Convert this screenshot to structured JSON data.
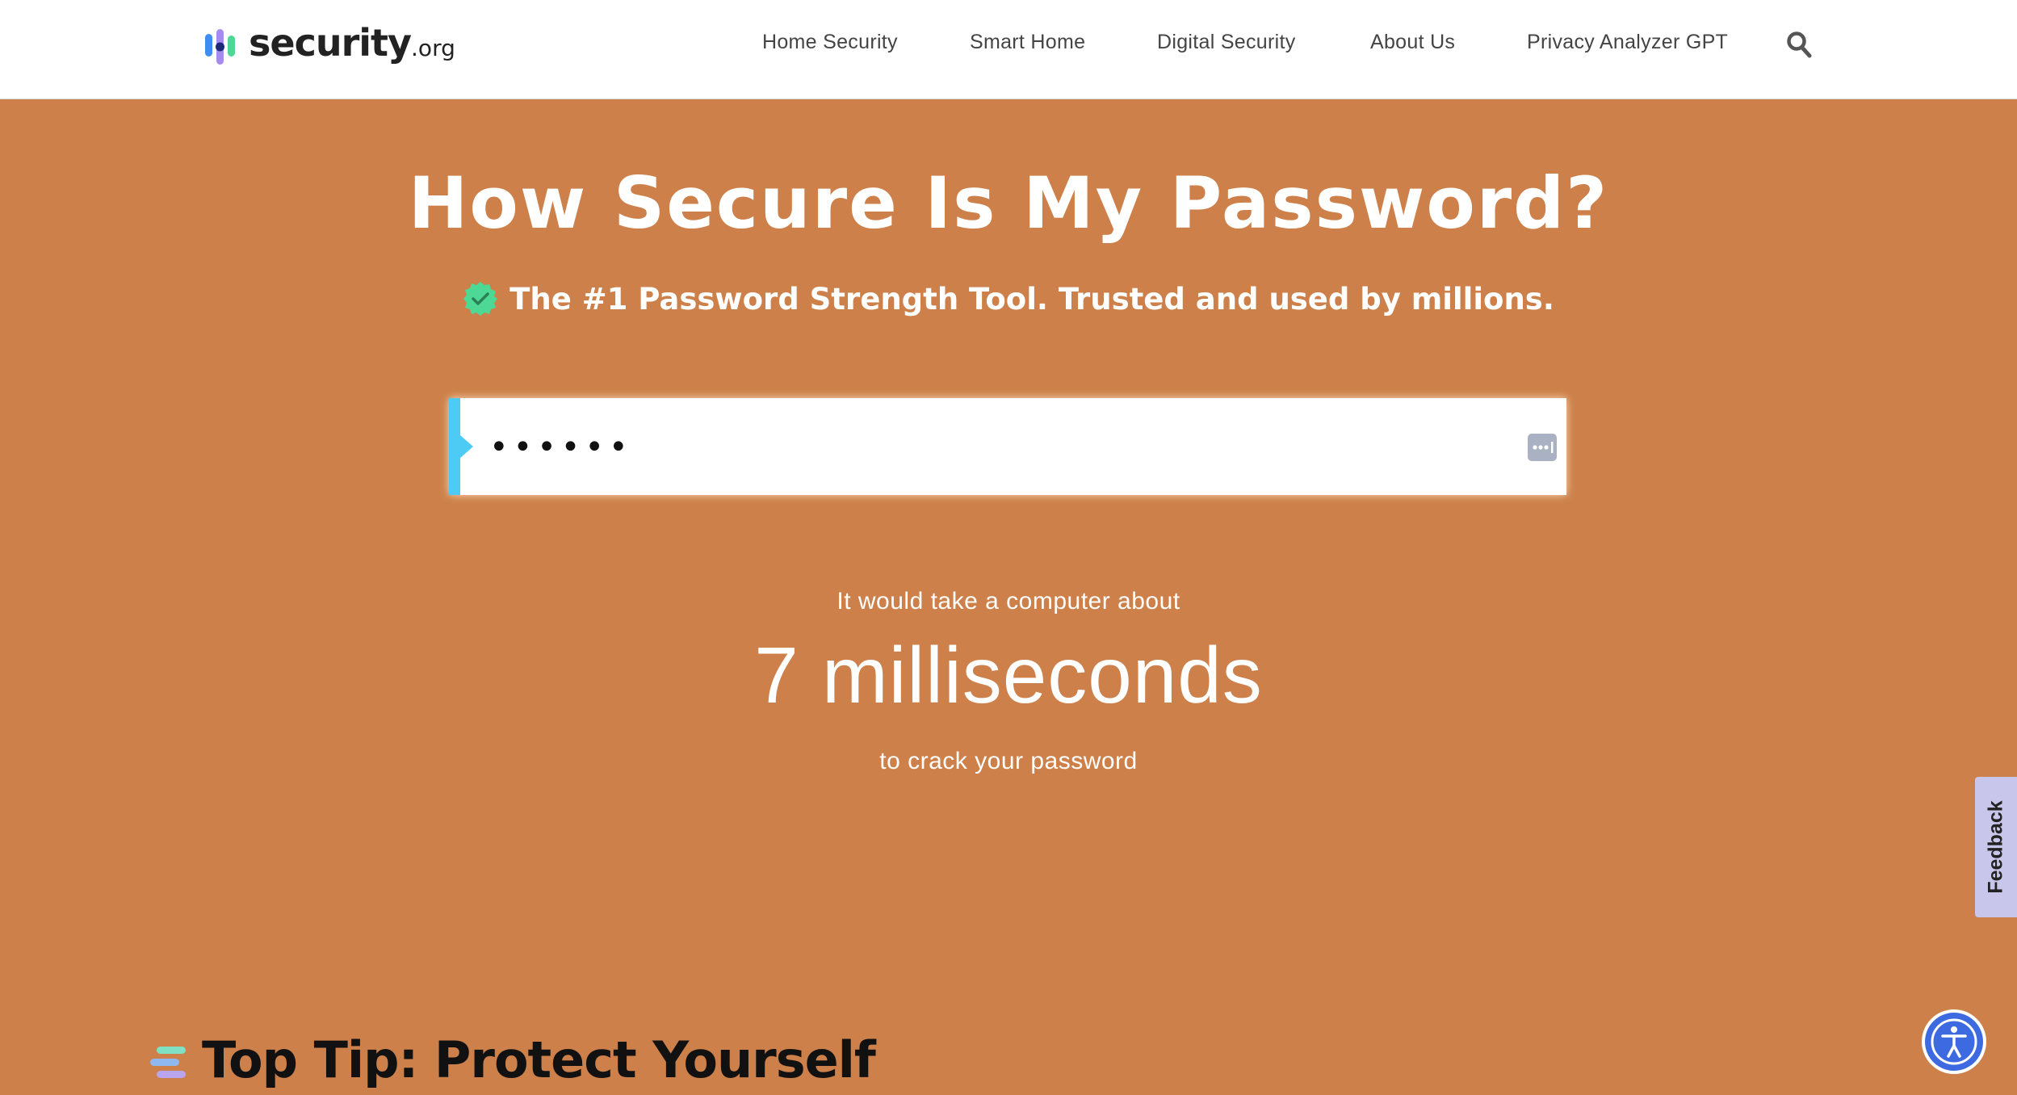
{
  "header": {
    "logo": {
      "name": "security",
      "suffix": ".org"
    },
    "nav": [
      {
        "label": "Home Security"
      },
      {
        "label": "Smart Home"
      },
      {
        "label": "Digital Security"
      },
      {
        "label": "About Us"
      },
      {
        "label": "Privacy Analyzer GPT"
      }
    ],
    "search_icon": "search-icon"
  },
  "hero": {
    "title": "How Secure Is My Password?",
    "tagline": "The #1 Password Strength Tool. Trusted and used by millions.",
    "tagline_icon": "verified-badge-icon"
  },
  "password_field": {
    "value": "••••••",
    "reveal_icon": "password-manager-icon"
  },
  "result": {
    "prefix": "It would take a computer about",
    "time": "7 milliseconds",
    "suffix": "to crack your password"
  },
  "tip": {
    "title": "Top Tip: Protect Yourself",
    "icon": "list-lines-icon"
  },
  "feedback_tab": {
    "label": "Feedback"
  },
  "accessibility_button": {
    "icon": "accessibility-icon"
  },
  "colors": {
    "background": "#CD8049",
    "accent": "#4DCBF5",
    "badge": "#4ED896",
    "a11y": "#3E6AE1"
  }
}
